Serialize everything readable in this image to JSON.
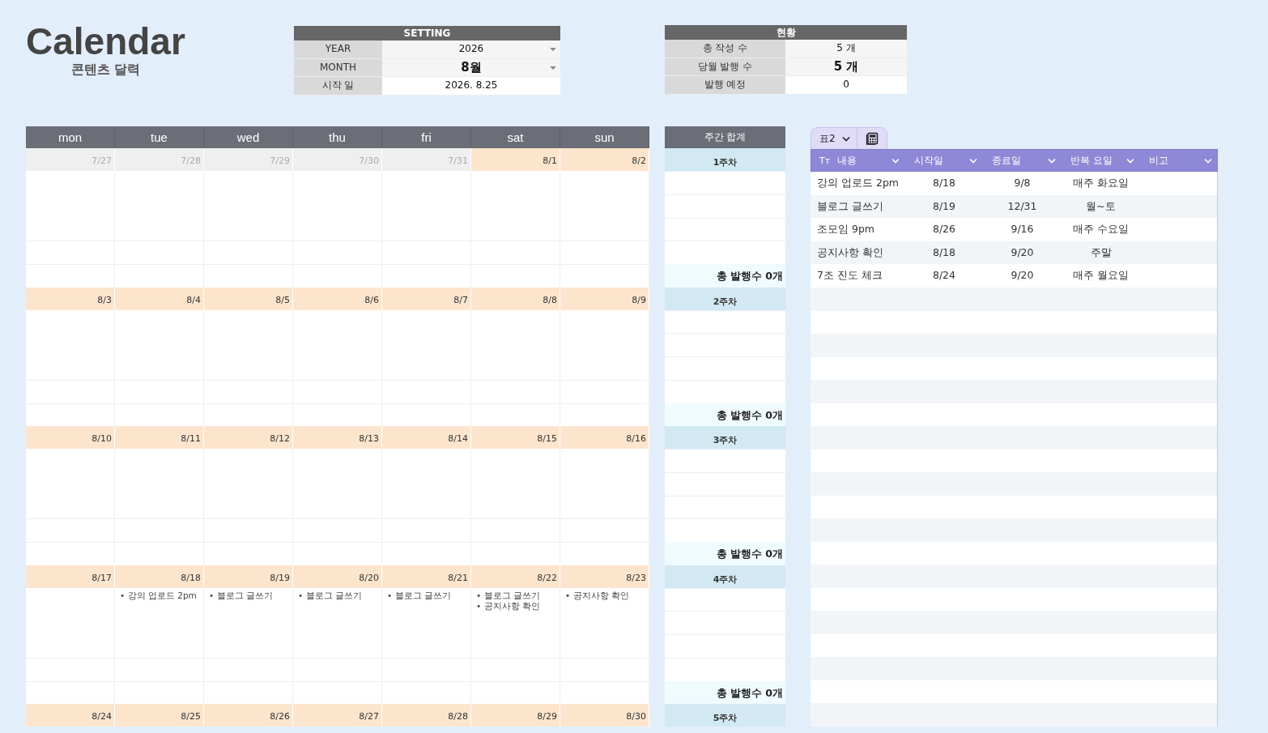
{
  "title": "Calendar",
  "subtitle": "콘텐츠 달력",
  "setting": {
    "title": "SETTING",
    "rows": [
      {
        "label": "YEAR",
        "value": "2026",
        "dropdown": true,
        "emphasis": false
      },
      {
        "label": "MONTH",
        "value": "8월",
        "dropdown": true,
        "emphasis": true
      },
      {
        "label": "시작 일",
        "value": "2026. 8.25",
        "dropdown": false,
        "emphasis": false
      }
    ]
  },
  "status": {
    "title": "현황",
    "rows": [
      {
        "label": "총 작성 수",
        "value": "5 개",
        "emphasis": false
      },
      {
        "label": "당월 발행 수",
        "value": "5 개",
        "emphasis": true
      },
      {
        "label": "발행 예정",
        "value": "0",
        "emphasis": false
      }
    ]
  },
  "calendar": {
    "weekdays": [
      "mon",
      "tue",
      "wed",
      "thu",
      "fri",
      "sat",
      "sun"
    ],
    "weekly_title": "주간 합계",
    "weeks": [
      {
        "label": "1주차",
        "total": "총 발행수 0개",
        "days": [
          {
            "date": "7/27",
            "in_month": false
          },
          {
            "date": "7/28",
            "in_month": false
          },
          {
            "date": "7/29",
            "in_month": false
          },
          {
            "date": "7/30",
            "in_month": false
          },
          {
            "date": "7/31",
            "in_month": false
          },
          {
            "date": "8/1",
            "in_month": true
          },
          {
            "date": "8/2",
            "in_month": true
          }
        ]
      },
      {
        "label": "2주차",
        "total": "총 발행수 0개",
        "days": [
          {
            "date": "8/3",
            "in_month": true
          },
          {
            "date": "8/4",
            "in_month": true
          },
          {
            "date": "8/5",
            "in_month": true
          },
          {
            "date": "8/6",
            "in_month": true
          },
          {
            "date": "8/7",
            "in_month": true
          },
          {
            "date": "8/8",
            "in_month": true
          },
          {
            "date": "8/9",
            "in_month": true
          }
        ]
      },
      {
        "label": "3주차",
        "total": "총 발행수 0개",
        "days": [
          {
            "date": "8/10",
            "in_month": true
          },
          {
            "date": "8/11",
            "in_month": true
          },
          {
            "date": "8/12",
            "in_month": true
          },
          {
            "date": "8/13",
            "in_month": true
          },
          {
            "date": "8/14",
            "in_month": true
          },
          {
            "date": "8/15",
            "in_month": true
          },
          {
            "date": "8/16",
            "in_month": true
          }
        ]
      },
      {
        "label": "4주차",
        "total": "총 발행수 0개",
        "days": [
          {
            "date": "8/17",
            "in_month": true
          },
          {
            "date": "8/18",
            "in_month": true,
            "events": [
              "• 강의 업로드 2pm"
            ]
          },
          {
            "date": "8/19",
            "in_month": true,
            "events": [
              "• 블로그 글쓰기"
            ]
          },
          {
            "date": "8/20",
            "in_month": true,
            "events": [
              "• 블로그 글쓰기"
            ]
          },
          {
            "date": "8/21",
            "in_month": true,
            "events": [
              "• 블로그 글쓰기"
            ]
          },
          {
            "date": "8/22",
            "in_month": true,
            "events": [
              "• 블로그 글쓰기",
              "• 공지사항 확인"
            ]
          },
          {
            "date": "8/23",
            "in_month": true,
            "events": [
              "• 공지사항 확인"
            ]
          }
        ]
      },
      {
        "label": "5주차",
        "days": [
          {
            "date": "8/24",
            "in_month": true
          },
          {
            "date": "8/25",
            "in_month": true
          },
          {
            "date": "8/26",
            "in_month": true
          },
          {
            "date": "8/27",
            "in_month": true
          },
          {
            "date": "8/28",
            "in_month": true
          },
          {
            "date": "8/29",
            "in_month": true
          },
          {
            "date": "8/30",
            "in_month": true
          }
        ]
      }
    ]
  },
  "table": {
    "tab": "표2",
    "columns": [
      {
        "label": "내용",
        "type_icon": "Tт"
      },
      {
        "label": "시작일"
      },
      {
        "label": "종료일"
      },
      {
        "label": "반복 요일"
      },
      {
        "label": "비고"
      }
    ],
    "rows": [
      [
        "강의 업로드 2pm",
        "8/18",
        "9/8",
        "매주 화요일"
      ],
      [
        "블로그 글쓰기",
        "8/19",
        "12/31",
        "월~토"
      ],
      [
        "조모임 9pm",
        "8/26",
        "9/16",
        "매주 수요일"
      ],
      [
        "공지사항 확인",
        "8/18",
        "9/20",
        "주말"
      ],
      [
        "7조 진도 체크",
        "8/24",
        "9/20",
        "매주 월요일"
      ]
    ]
  }
}
